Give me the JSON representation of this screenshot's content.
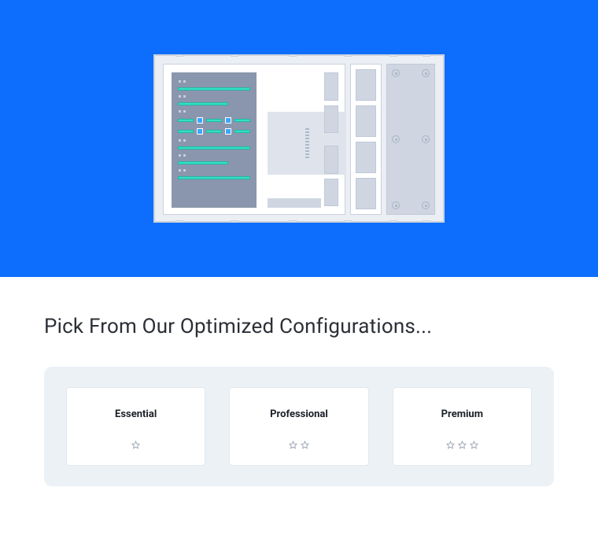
{
  "heading": "Pick From Our Optimized Configurations...",
  "plans": [
    {
      "name": "Essential",
      "stars": 1
    },
    {
      "name": "Professional",
      "stars": 2
    },
    {
      "name": "Premium",
      "stars": 3
    }
  ]
}
